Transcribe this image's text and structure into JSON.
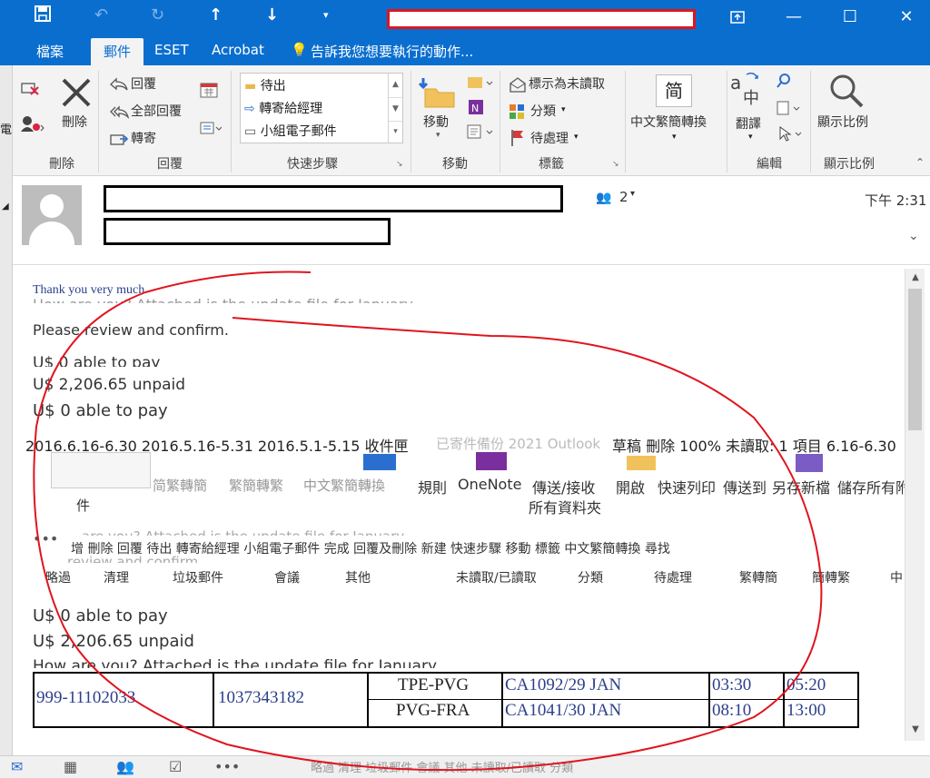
{
  "titlebar": {
    "save_icon": "save-icon",
    "undo_icon": "undo-icon",
    "redo_icon": "redo-icon",
    "up_icon": "arrow-up-icon",
    "down_icon": "arrow-down-icon",
    "customize_icon": "chevron-down-icon"
  },
  "tabs": {
    "file": "檔案",
    "mail": "郵件",
    "eset": "ESET",
    "acrobat": "Acrobat",
    "tellme": "告訴我您想要執行的動作..."
  },
  "ribbon": {
    "delete": {
      "delete_label": "刪除",
      "group": "刪除"
    },
    "respond": {
      "reply": "回覆",
      "reply_all": "全部回覆",
      "forward": "轉寄",
      "group": "回覆"
    },
    "quicksteps": {
      "items": [
        "待出",
        "轉寄給經理",
        "小組電子郵件"
      ],
      "group": "快速步驟"
    },
    "move": {
      "move_label": "移動",
      "group": "移動"
    },
    "tags": {
      "unread": "標示為未讀取",
      "categorize": "分類",
      "followup": "待處理",
      "group": "標籤"
    },
    "chinese": {
      "convert_label": "中文繁簡轉換",
      "icon_char": "简"
    },
    "editing": {
      "translate": "翻譯",
      "group": "編輯"
    },
    "zoom": {
      "zoom_label": "顯示比例",
      "group": "顯示比例"
    }
  },
  "header": {
    "people_count": "2",
    "time": "下午 2:31"
  },
  "body": {
    "thanks": "Thank you very much",
    "ghost_line": "How are you? Attached is the update file for January",
    "review": "Please review and confirm.",
    "able0_cut": "U$ 0 able to pay",
    "unpaid": "U$ 2,206.65   unpaid",
    "able0": "U$ 0 able to pay",
    "folders_line": "2016.6.16-6.30 2016.5.16-5.31 2016.5.1-5.15 收件匣",
    "folders_faded": "已寄件備份   2021   Outlook",
    "status_right": "草稿 刪除 100% 未讀取: 1 項目 6.16-6.30",
    "ribbon_overlay_1": [
      "简繁轉簡",
      "繁簡轉繁",
      "中文繁簡轉換",
      "規則",
      "OneNote",
      "傳送/接收",
      "開啟",
      "快速列印",
      "傳送到",
      "另存新檔",
      "儲存所有附"
    ],
    "ribbon_overlay_1_sub": "所有資料夾",
    "ribbon_overlay_1_small": "件",
    "ghost_line2": "are you? Attached is the update file for January",
    "ribbon_overlay_2": "增 刪除 回覆 待出 轉寄給經理 小組電子郵件 完成 回覆及刪除 新建 快速步驟 移動 標籤 中文繁簡轉換 尋找",
    "ribbon_overlay_3": [
      "略過",
      "清理",
      "垃圾郵件",
      "會議",
      "其他",
      "未讀取/已讀取",
      "分類",
      "待處理",
      "繁轉簡",
      "簡轉繁",
      "中"
    ],
    "review_ghost": "review and confirm",
    "able0_b": "U$ 0 able to pay",
    "unpaid_b": "U$ 2,206.65   unpaid",
    "ghost_line3": "How are you? Attached is the update file for January",
    "bottom_ghost": "略過  清理  垃圾郵件  會議  其他  未讀取/已讀取  分類"
  },
  "table": {
    "ref": "999-11102033",
    "num": "1037343182",
    "route1": "TPE-PVG",
    "route2": "PVG-FRA",
    "flight1": "CA1092/29 JAN",
    "flight2": "CA1041/30 JAN",
    "dep1": "03:30",
    "dep2": "08:10",
    "arr1": "05:20",
    "arr2": "13:00"
  },
  "colors": {
    "accent": "#0a6ecf",
    "annotation": "#e0141e"
  }
}
